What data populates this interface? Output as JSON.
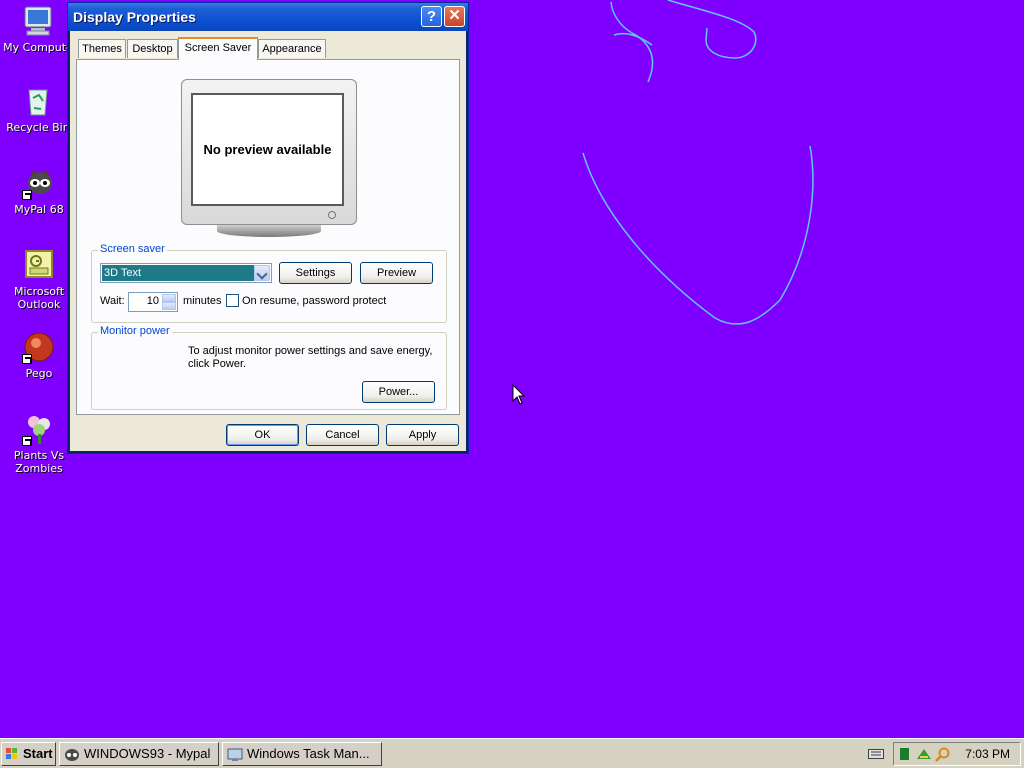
{
  "desktop": {
    "icons": [
      {
        "label": "My Compute",
        "icon": "my-computer-icon"
      },
      {
        "label": "Recycle Bin",
        "icon": "recycle-bin-icon"
      },
      {
        "label": "MyPal 68",
        "icon": "mypal-icon"
      },
      {
        "label": "Microsoft Outlook",
        "icon": "outlook-icon"
      },
      {
        "label": "Pego",
        "icon": "pego-icon"
      },
      {
        "label": "Plants Vs Zombies",
        "icon": "plants-vs-zombies-icon"
      }
    ],
    "background_color": "#7f00ff",
    "doodle_color": "#5ec8f0"
  },
  "dialog": {
    "title": "Display Properties",
    "help_button": "?",
    "close_button": "✕",
    "tabs": [
      {
        "label": "Themes",
        "active": false
      },
      {
        "label": "Desktop",
        "active": false
      },
      {
        "label": "Screen Saver",
        "active": true
      },
      {
        "label": "Appearance",
        "active": false
      }
    ],
    "preview": {
      "text": "No preview available"
    },
    "screen_saver": {
      "group_label": "Screen saver",
      "selected": "3D Text",
      "settings_button": "Settings",
      "preview_button": "Preview",
      "wait_label": "Wait:",
      "wait_value": "10",
      "minutes_label": "minutes",
      "password_label": "On resume, password protect",
      "password_checked": false
    },
    "monitor_power": {
      "group_label": "Monitor power",
      "description": "To adjust monitor power settings and save energy, click Power.",
      "power_button": "Power..."
    },
    "buttons": {
      "ok": "OK",
      "cancel": "Cancel",
      "apply": "Apply"
    }
  },
  "taskbar": {
    "start_label": "Start",
    "tasks": [
      {
        "label": "WINDOWS93 - Mypal",
        "icon": "mypal-task-icon"
      },
      {
        "label": "Windows Task Man...",
        "icon": "task-manager-icon"
      }
    ],
    "clock": "7:03 PM"
  }
}
